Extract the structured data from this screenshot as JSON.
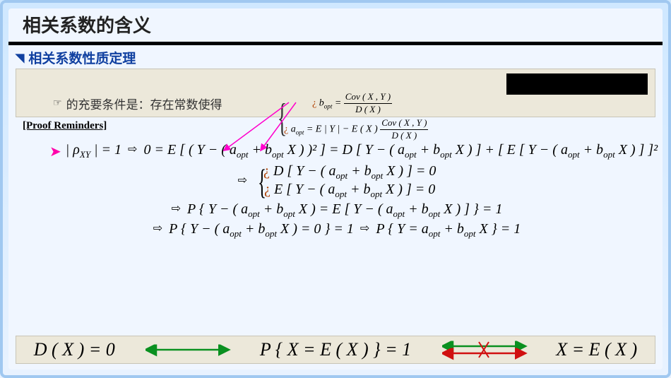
{
  "title": "相关系数的含义",
  "subtitle": "相关系数性质定理",
  "condition_text": "的充要条件是：存在常数使得",
  "proof_header": "[Proof Reminders]",
  "defs": {
    "b_lhs": "b",
    "b_sub": "opt",
    "b_rhs_num": "Cov ( X , Y )",
    "b_rhs_den": "D ( X )",
    "a_lhs": "a",
    "a_sub": "opt",
    "a_rhs_pre": "= E | Y | − E ( X )",
    "a_rhs_num": "Cov ( X , Y )",
    "a_rhs_den": "D ( X )"
  },
  "line1": {
    "lhs": "| ρ",
    "lhs_sub": "XY",
    "lhs_rest": " | = 1",
    "imp": "⇨",
    "body": "0 = E [ ( Y − ( a",
    "s1": "opt",
    "m1": " + b",
    "s2": "opt",
    "m2": " X ) )² ] = D [ Y − ( a",
    "s3": "opt",
    "m3": " + b",
    "s4": "opt",
    "m4": " X ) ] + [ E [ Y − ( a",
    "s5": "opt",
    "m5": " + b",
    "s6": "opt",
    "m6": " X ) ] ]²"
  },
  "line2": {
    "imp": "⇨",
    "top_pre": "D [ Y − ( a",
    "s1": "opt",
    "top_mid": " + b",
    "s2": "opt",
    "top_end": " X ) ] = 0",
    "bot_pre": "E [ Y − ( a",
    "s3": "opt",
    "bot_mid": " + b",
    "s4": "opt",
    "bot_end": " X ) ] = 0"
  },
  "line3": {
    "imp": "⇨",
    "body_pre": "P { Y − ( a",
    "s1": "opt",
    "m1": " + b",
    "s2": "opt",
    "m2": " X ) = E [ Y − ( a",
    "s3": "opt",
    "m3": " + b",
    "s4": "opt",
    "m4": " X ) ] } = 1"
  },
  "line4": {
    "imp": "⇨",
    "body_pre": "P { Y − ( a",
    "s1": "opt",
    "m1": " + b",
    "s2": "opt",
    "m2": " X ) = 0 } = 1",
    "imp2": "⇨",
    "body2_pre": "P { Y = a",
    "s3": "opt",
    "m3": " + b",
    "s4": "opt",
    "m4": " X } = 1"
  },
  "bottom": {
    "left": "D ( X ) = 0",
    "mid": "P { X = E ( X ) } = 1",
    "right": "X = E ( X )"
  }
}
